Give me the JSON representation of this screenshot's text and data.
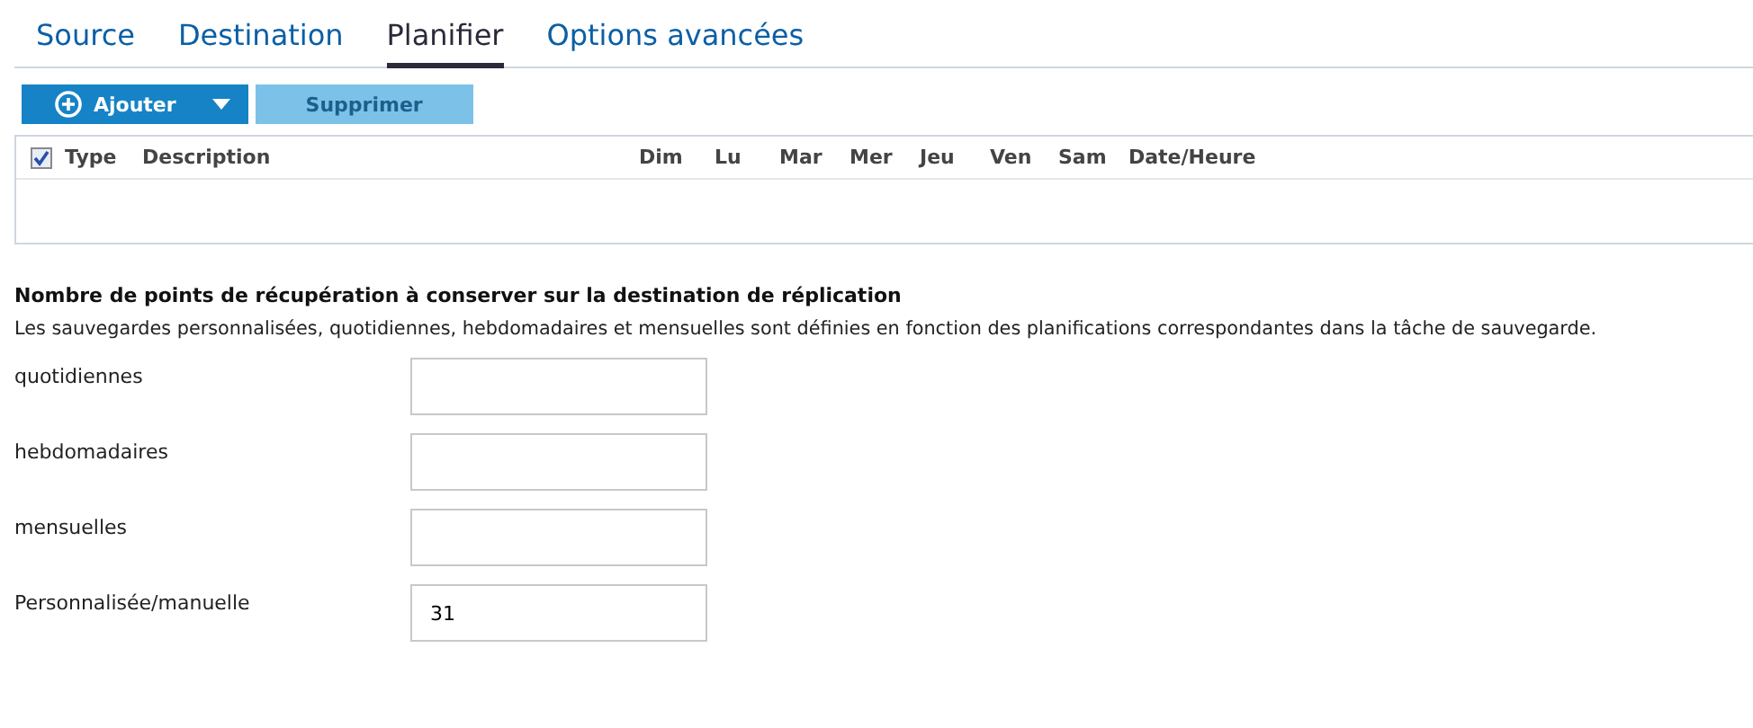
{
  "tabs": [
    {
      "label": "Source",
      "selected": false
    },
    {
      "label": "Destination",
      "selected": false
    },
    {
      "label": "Planifier",
      "selected": true
    },
    {
      "label": "Options avancées",
      "selected": false
    }
  ],
  "toolbar": [
    {
      "label": "Ajouter",
      "kind": "add",
      "disabled": false
    },
    {
      "label": "Supprimer",
      "kind": "plain",
      "disabled": true
    }
  ],
  "table": {
    "select_all_checked": true,
    "columns": [
      "Type",
      "Description",
      "Dim",
      "Lu",
      "Mar",
      "Mer",
      "Jeu",
      "Ven",
      "Sam",
      "Date/Heure"
    ]
  },
  "retention": {
    "title": "Nombre de points de récupération à conserver sur la destination de réplication",
    "description": "Les sauvegardes personnalisées, quotidiennes, hebdomadaires et mensuelles sont définies en fonction des planifications correspondantes dans la tâche de sauvegarde.",
    "fields": [
      {
        "label": "quotidiennes"
      },
      {
        "label": "hebdomadaires"
      },
      {
        "label": "mensuelles"
      },
      {
        "label": "Personnalisée/manuelle",
        "value": "31"
      }
    ]
  }
}
